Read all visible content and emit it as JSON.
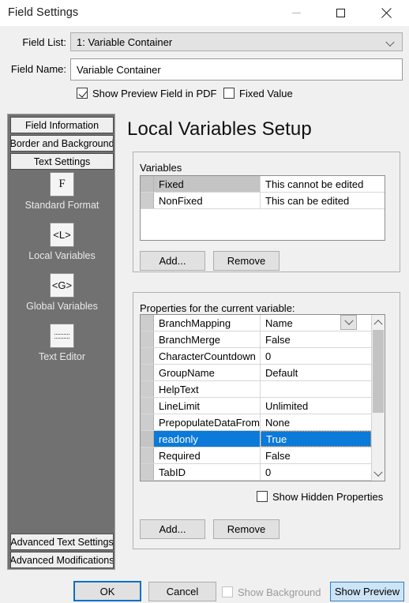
{
  "window": {
    "title": "Field Settings",
    "controls": {
      "minimize": "minimize",
      "maximize": "maximize",
      "close": "close"
    }
  },
  "form": {
    "field_list_label": "Field List:",
    "field_list_value": "1: Variable Container",
    "field_name_label": "Field Name:",
    "field_name_value": "Variable Container",
    "field_name_placeholder": "",
    "show_preview_field_label": "Show Preview Field in PDF",
    "show_preview_field_checked": true,
    "fixed_value_label": "Fixed Value",
    "fixed_value_checked": false
  },
  "sidebar": {
    "top_tabs": [
      {
        "label": "Field Information"
      },
      {
        "label": "Border and Background"
      },
      {
        "label": "Text Settings"
      }
    ],
    "icons": [
      {
        "glyph": "F",
        "label": "Standard Format",
        "icon_name": "standard-format-icon"
      },
      {
        "glyph": "<L>",
        "label": "Local Variables",
        "icon_name": "local-variables-icon"
      },
      {
        "glyph": "<G>",
        "label": "Global Variables",
        "icon_name": "global-variables-icon"
      },
      {
        "glyph": "",
        "label": "Text Editor",
        "icon_name": "text-editor-icon"
      }
    ],
    "bottom_tabs": [
      {
        "label": "Advanced Text Settings"
      },
      {
        "label": "Advanced Modifications"
      }
    ]
  },
  "main": {
    "heading": "Local Variables Setup",
    "variables_group": {
      "caption": "Variables",
      "rows": [
        {
          "name": "Fixed",
          "value": "This cannot be edited",
          "selected": true
        },
        {
          "name": "NonFixed",
          "value": "This can be edited",
          "selected": false
        }
      ],
      "add_label": "Add...",
      "remove_label": "Remove"
    },
    "properties_group": {
      "caption": "Properties for the current variable:",
      "rows": [
        {
          "name": "BranchMapping",
          "value": "Name",
          "selected": false
        },
        {
          "name": "BranchMerge",
          "value": "False",
          "selected": false
        },
        {
          "name": "CharacterCountdown",
          "value": "0",
          "selected": false
        },
        {
          "name": "GroupName",
          "value": "Default",
          "selected": false
        },
        {
          "name": "HelpText",
          "value": "",
          "selected": false
        },
        {
          "name": "LineLimit",
          "value": "Unlimited",
          "selected": false
        },
        {
          "name": "PrepopulateDataFrom",
          "value": "None",
          "selected": false
        },
        {
          "name": "readonly",
          "value": "True",
          "selected": true
        },
        {
          "name": "Required",
          "value": "False",
          "selected": false
        },
        {
          "name": "TabID",
          "value": "0",
          "selected": false
        }
      ],
      "show_hidden_label": "Show Hidden Properties",
      "show_hidden_checked": false,
      "add_label": "Add...",
      "remove_label": "Remove"
    }
  },
  "footer": {
    "ok_label": "OK",
    "cancel_label": "Cancel",
    "show_background_label": "Show Background",
    "show_background_checked": false,
    "show_background_disabled": true,
    "show_preview_label": "Show Preview"
  },
  "colors": {
    "accent_blue": "#0b7ad8",
    "focus_border": "#0a70c8",
    "preview_bg": "#cde4f7",
    "sidebar_bg": "#717171",
    "dialog_bg": "#f0f0f0"
  }
}
